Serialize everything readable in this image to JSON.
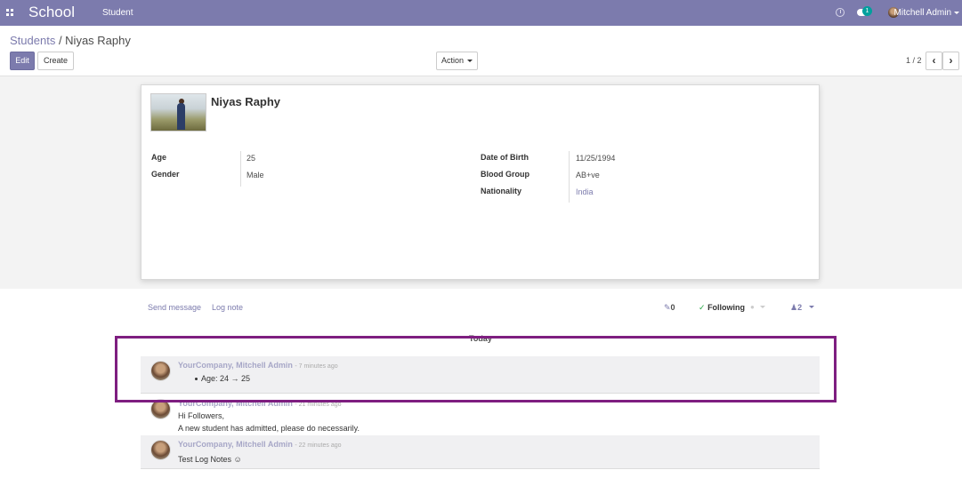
{
  "navbar": {
    "brand": "School",
    "menu_student": "Student",
    "chat_count": "1",
    "user_name": "Mitchell Admin",
    "color": "#7c7bad"
  },
  "control_panel": {
    "breadcrumb_parent": "Students",
    "breadcrumb_sep": " / ",
    "breadcrumb_current": "Niyas Raphy",
    "edit_label": "Edit",
    "create_label": "Create",
    "action_label": "Action",
    "pager_value": "1 / 2"
  },
  "student": {
    "name": "Niyas Raphy",
    "fields_left": [
      {
        "label": "Age",
        "value": "25"
      },
      {
        "label": "Gender",
        "value": "Male"
      }
    ],
    "fields_right": [
      {
        "label": "Date of Birth",
        "value": "11/25/1994"
      },
      {
        "label": "Blood Group",
        "value": "AB+ve"
      },
      {
        "label": "Nationality",
        "value": "India"
      }
    ]
  },
  "chatter": {
    "send_message": "Send message",
    "log_note": "Log note",
    "attachments_count": "0",
    "following_label": "Following",
    "followers_count": "2",
    "day_label": "Today",
    "messages": [
      {
        "author": "YourCompany, Mitchell Admin",
        "date": "- 7 minutes ago",
        "lines": [
          "Age: 24 → 25"
        ]
      },
      {
        "author": "YourCompany, Mitchell Admin",
        "date": "- 21 minutes ago",
        "lines": [
          "Hi Followers,",
          "A new student has admitted, please do necessarily."
        ]
      },
      {
        "author": "YourCompany, Mitchell Admin",
        "date": "- 22 minutes ago",
        "lines": [
          "Test Log Notes ☺"
        ]
      }
    ]
  },
  "annotation": {
    "highlight_color": "#7e1e80"
  }
}
